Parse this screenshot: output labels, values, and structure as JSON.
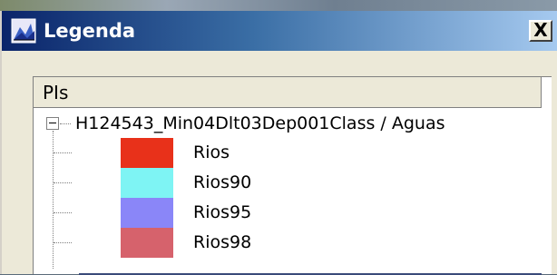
{
  "window": {
    "title": "Legenda",
    "close_label": "X"
  },
  "panel": {
    "column_header": "PIs",
    "tree": {
      "root_label": "H124543_Min04Dlt03Dep001Class / Aguas",
      "expanded": true,
      "items": [
        {
          "label": "Rios",
          "color": "#e8311a"
        },
        {
          "label": "Rios90",
          "color": "#7ef4f4"
        },
        {
          "label": "Rios95",
          "color": "#8a86f8"
        },
        {
          "label": "Rios98",
          "color": "#d6626c"
        }
      ]
    }
  },
  "icons": {
    "app": "legend-map-icon",
    "expander": "tree-collapse-icon",
    "close": "close-icon"
  }
}
